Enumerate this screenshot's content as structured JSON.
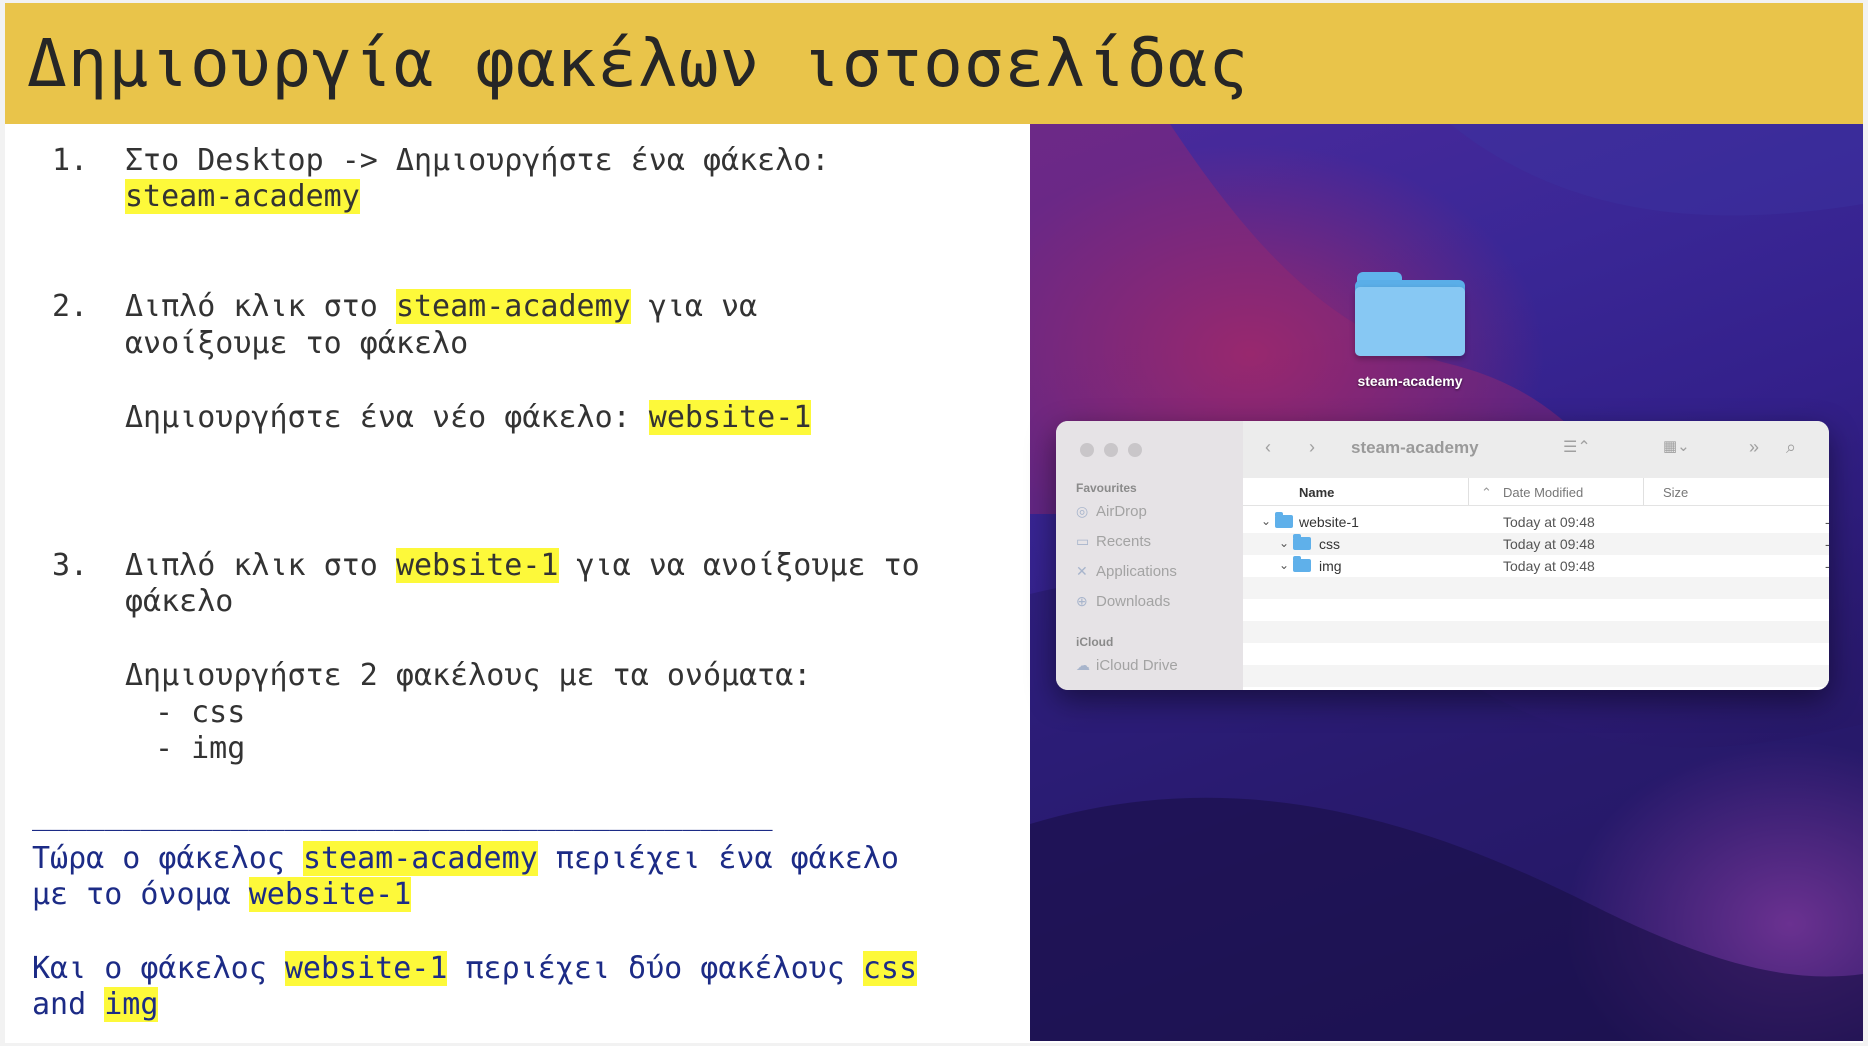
{
  "slide": {
    "title": "Δημιουργία φακέλων ιστοσελίδας",
    "steps": [
      {
        "number": "1.",
        "line1_text": "Στο Desktop -> Δημιουργήστε ένα φάκελο:",
        "line2_highlight": "steam-academy"
      },
      {
        "number": "2.",
        "line1_pre": "Διπλό κλικ στο ",
        "line1_highlight": "steam-academy",
        "line1_post": " για να",
        "line2_text": "ανοίξουμε το φάκελο",
        "line3_pre": "Δημιουργήστε ένα νέο φάκελο: ",
        "line3_highlight": "website-1"
      },
      {
        "number": "3.",
        "line1_pre": "Διπλό κλικ στο ",
        "line1_highlight": "website-1",
        "line1_post": " για να ανοίξουμε το",
        "line2_text": "φάκελο",
        "line3_text": "Δημιουργήστε 2 φακέλους με τα ονόματα:",
        "bullets": [
          "-   css",
          "-   img"
        ]
      }
    ],
    "separator": "_________________________________________",
    "summary": {
      "p1_pre": "Τώρα ο φάκελος ",
      "p1_hl1": "steam-academy",
      "p1_post": " περιέχει ένα φάκελο",
      "p1_line2_pre": "με το όνομα ",
      "p1_hl2": "website-1",
      "p2_pre": "Και ο φάκελος ",
      "p2_hl1": "website-1",
      "p2_mid": " περιέχει δύο φακέλους ",
      "p2_hl2": "css",
      "p2_line2_pre": "and ",
      "p2_hl3": "img"
    },
    "highlight_color": "#fdf93a",
    "title_bar_color": "#e9c44a",
    "summary_text_color": "#1c2b86"
  },
  "desktop": {
    "folder_label": "steam-academy",
    "finder": {
      "window_title": "steam-academy",
      "sidebar": {
        "favourites_heading": "Favourites",
        "favourites": [
          {
            "label": "AirDrop",
            "icon": "airdrop-icon"
          },
          {
            "label": "Recents",
            "icon": "recents-icon"
          },
          {
            "label": "Applications",
            "icon": "applications-icon"
          },
          {
            "label": "Downloads",
            "icon": "downloads-icon"
          }
        ],
        "icloud_heading": "iCloud",
        "icloud": [
          {
            "label": "iCloud Drive",
            "icon": "icloud-drive-icon"
          }
        ]
      },
      "columns": {
        "name": "Name",
        "date_modified": "Date Modified",
        "size": "Size"
      },
      "rows": [
        {
          "name": "website-1",
          "date": "Today at 09:48",
          "size": "-"
        },
        {
          "name": "css",
          "date": "Today at 09:48",
          "size": "-"
        },
        {
          "name": "img",
          "date": "Today at 09:48",
          "size": "-"
        }
      ]
    }
  }
}
